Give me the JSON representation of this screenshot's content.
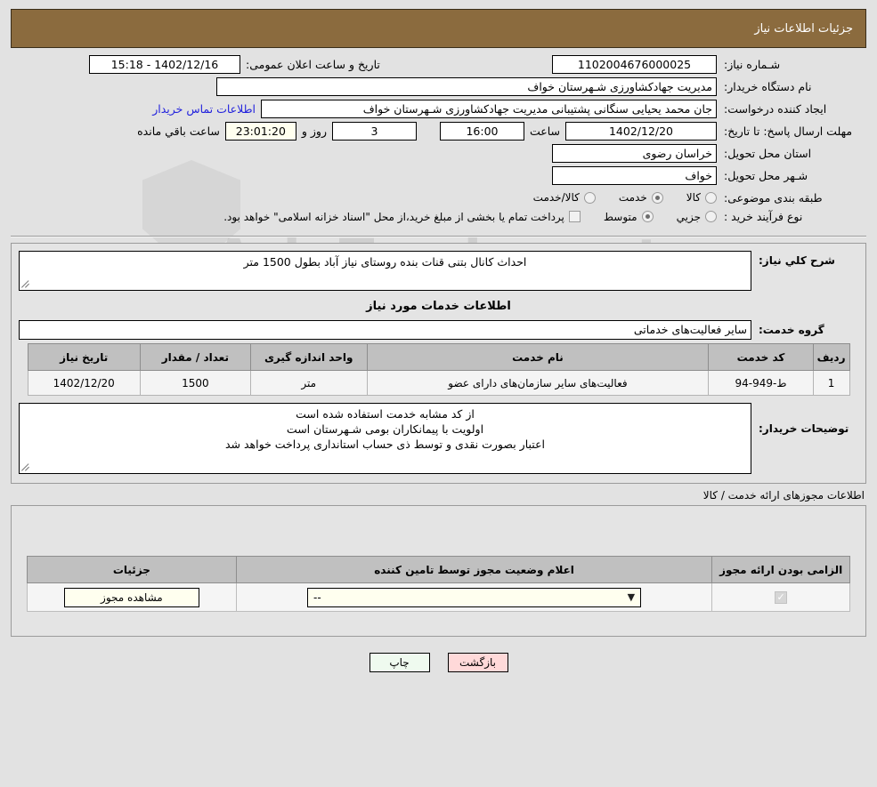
{
  "header": {
    "title": "جزئیات اطلاعات نیاز"
  },
  "watermark": {
    "text": "AriaTender.net"
  },
  "top_form": {
    "need_number": {
      "label": "شـماره نیاز:",
      "value": "1102004676000025"
    },
    "announce_datetime": {
      "label": "تاریخ و ساعت اعلان عمومی:",
      "value": "1402/12/16 - 15:18"
    },
    "buyer_org": {
      "label": "نام دستگاه خریدار:",
      "value": "مدیریت جهادکشاورزی شـهرستان خواف"
    },
    "creator": {
      "label": "ایجاد کننده درخواست:",
      "value": "جان محمد یحیایی سنگانی پشتیبانی مدیریت جهادکشاورزی شـهرستان خواف"
    },
    "contact_link": "اطلاعات تماس خریدار",
    "deadline": {
      "label": "مهلت ارسال پاسخ: تا تاریخ:",
      "date": "1402/12/20",
      "hour_label": "ساعت",
      "hour": "16:00",
      "days": "3",
      "days_label": "روز و",
      "countdown": "23:01:20",
      "countdown_label": "ساعت باقي مانده"
    },
    "province": {
      "label": "استان محل تحویل:",
      "value": "خراسان رضوی"
    },
    "city": {
      "label": "شـهر محل تحویل:",
      "value": "خواف"
    },
    "category": {
      "label": "طبقه بندی موضوعی:",
      "options": [
        {
          "label": "کالا",
          "selected": false
        },
        {
          "label": "خدمت",
          "selected": true
        },
        {
          "label": "کالا/خدمت",
          "selected": false
        }
      ]
    },
    "purchase_type": {
      "label": "نوع فرآیند خرید :",
      "options": [
        {
          "label": "جزیي",
          "selected": false
        },
        {
          "label": "متوسط",
          "selected": true
        }
      ],
      "checkbox_note": "پرداخت تمام یا بخشی از مبلغ خرید،از محل \"اسناد خزانه اسلامی\" خواهد بود.",
      "checkbox_checked": false
    }
  },
  "need_description": {
    "label": "شرح کلي نیاز:",
    "value": "احداث کانال بتنی قنات بنده روستای نیاز آباد بطول 1500 متر"
  },
  "services_section": {
    "heading": "اطلاعات خدمات مورد نیاز",
    "service_group": {
      "label": "گروه خدمت:",
      "value": "سایر فعالیت‌های خدماتی"
    },
    "table": {
      "columns": [
        "ردیف",
        "کد خدمت",
        "نام خدمت",
        "واحد اندازه گیری",
        "تعداد / مقدار",
        "تاریخ نیاز"
      ],
      "rows": [
        {
          "row_no": "1",
          "service_code": "ط-949-94",
          "service_name": "فعالیت‌های سایر سازمان‌های دارای عضو",
          "unit": "متر",
          "quantity": "1500",
          "need_date": "1402/12/20"
        }
      ]
    }
  },
  "buyer_notes": {
    "label": "توضیحات خریدار:",
    "lines": [
      "از کد مشابه خدمت استفاده شده است",
      "اولویت با پیمانکاران بومی شـهرستان است",
      "اعتبار بصورت نقدی و توسط ذی حساب استانداری پرداخت خواهد شد"
    ]
  },
  "licenses": {
    "title": "اطلاعات مجوزهای ارائه خدمت / کالا",
    "columns": [
      "الزامی بودن ارائه مجوز",
      "اعلام وضعیت مجوز توسط تامین کننده",
      "جزئیات"
    ],
    "rows": [
      {
        "required_checked": true,
        "status_value": "--",
        "details_button": "مشاهده مجوز"
      }
    ]
  },
  "footer": {
    "print_label": "چاپ",
    "back_label": "بازگشت"
  },
  "colors": {
    "header_brown": "#8b6b3e",
    "link_blue": "#2222dd",
    "cream": "#ffffef",
    "print_green": "#effaef",
    "back_pink": "#ffd9d9"
  }
}
